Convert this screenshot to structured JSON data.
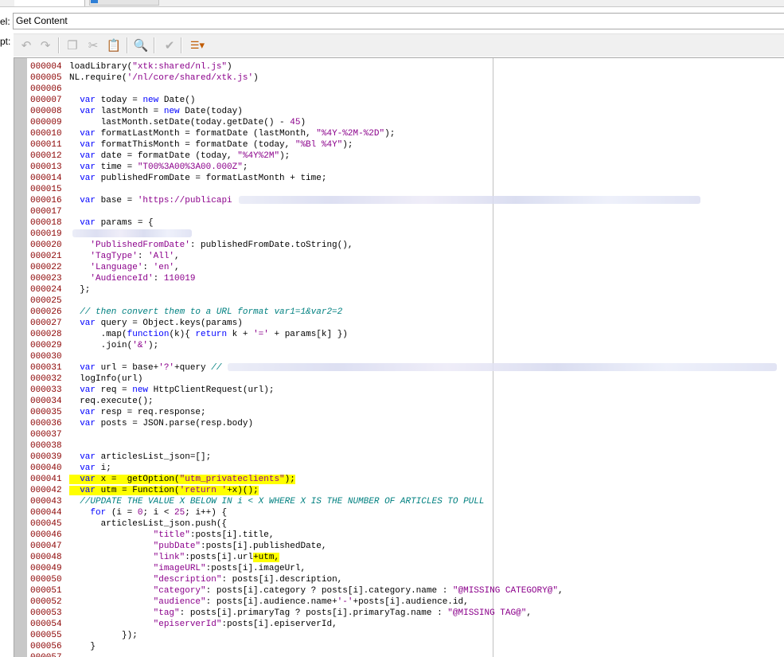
{
  "form": {
    "label_caption": "el:",
    "label_value": "Get Content",
    "script_caption": "pt:"
  },
  "toolbar": {
    "undo": "↶",
    "redo": "↷",
    "copy": "❐",
    "cut": "✂",
    "paste": "📋",
    "find": "🔍",
    "validate": "✔",
    "insert": "☰▾"
  },
  "code": {
    "line_numbers": [
      "000004",
      "000005",
      "000006",
      "000007",
      "000008",
      "000009",
      "000010",
      "000011",
      "000012",
      "000013",
      "000014",
      "000015",
      "000016",
      "000017",
      "000018",
      "000019",
      "000020",
      "000021",
      "000022",
      "000023",
      "000024",
      "000025",
      "000026",
      "000027",
      "000028",
      "000029",
      "000030",
      "000031",
      "000032",
      "000033",
      "000034",
      "000035",
      "000036",
      "000037",
      "000038",
      "000039",
      "000040",
      "000041",
      "000042",
      "000043",
      "000044",
      "000045",
      "000046",
      "000047",
      "000048",
      "000049",
      "000050",
      "000051",
      "000052",
      "000053",
      "000054",
      "000055",
      "000056",
      "000057"
    ],
    "lines": [
      [
        "loadLibrary(",
        "\"xtk:shared/nl.js\"",
        ")"
      ],
      [
        "NL.require(",
        "'/nl/core/shared/xtk.js'",
        ")"
      ],
      [
        ""
      ],
      [
        "  ",
        "var",
        " today = ",
        "new",
        " Date()"
      ],
      [
        "  ",
        "var",
        " lastMonth = ",
        "new",
        " Date(today)"
      ],
      [
        "      lastMonth.setDate(today.getDate() - ",
        "45",
        ")"
      ],
      [
        "  ",
        "var",
        " formatLastMonth = formatDate (lastMonth, ",
        "\"%4Y-%2M-%2D\"",
        ");"
      ],
      [
        "  ",
        "var",
        " formatThisMonth = formatDate (today, ",
        "\"%Bl %4Y\"",
        ");"
      ],
      [
        "  ",
        "var",
        " date = formatDate (today, ",
        "\"%4Y%2M\"",
        ");"
      ],
      [
        "  ",
        "var",
        " time = ",
        "\"T00%3A00%3A00.000Z\"",
        ";"
      ],
      [
        "  ",
        "var",
        " publishedFromDate = formatLastMonth + time;"
      ],
      [
        ""
      ],
      [
        "  ",
        "var",
        " base = ",
        "'https://publicapi"
      ],
      [
        ""
      ],
      [
        "  ",
        "var",
        " params = {"
      ],
      [
        ""
      ],
      [
        "    ",
        "'PublishedFromDate'",
        ": publishedFromDate.toString(),"
      ],
      [
        "    ",
        "'TagType'",
        ": ",
        "'All'",
        ","
      ],
      [
        "    ",
        "'Language'",
        ": ",
        "'en'",
        ","
      ],
      [
        "    ",
        "'AudienceId'",
        ": ",
        "110019"
      ],
      [
        "  };"
      ],
      [
        ""
      ],
      [
        "  ",
        "// then convert them to a URL format var1=1&var2=2"
      ],
      [
        "  ",
        "var",
        " query = Object.keys(params)"
      ],
      [
        "      .map(",
        "function",
        "(k){ ",
        "return",
        " k + ",
        "'='",
        " + params[k] })"
      ],
      [
        "      .join(",
        "'&'",
        ");"
      ],
      [
        ""
      ],
      [
        "  ",
        "var",
        " url = base+",
        "'?'",
        "+query ",
        "//"
      ],
      [
        "  logInfo(url)"
      ],
      [
        "  ",
        "var",
        " req = ",
        "new",
        " HttpClientRequest(url);"
      ],
      [
        "  req.execute();"
      ],
      [
        "  ",
        "var",
        " resp = req.response;"
      ],
      [
        "  ",
        "var",
        " posts = JSON.parse(resp.body)"
      ],
      [
        ""
      ],
      [
        ""
      ],
      [
        "  ",
        "var",
        " articlesList_json=[];"
      ],
      [
        "  ",
        "var",
        " i;"
      ],
      [
        "  ",
        "var",
        " x =  getOption(",
        "\"utm_privateclients\"",
        ");"
      ],
      [
        "  ",
        "var",
        " utm = Function(",
        "'return '",
        "+x)();"
      ],
      [
        "  ",
        "//UPDATE THE VALUE X BELOW IN i < X WHERE X IS THE NUMBER OF ARTICLES TO PULL"
      ],
      [
        "    ",
        "for",
        " (i = ",
        "0",
        "; i < ",
        "25",
        "; i++) {"
      ],
      [
        "      articlesList_json.push({"
      ],
      [
        "                ",
        "\"title\"",
        ":posts[i].title,"
      ],
      [
        "                ",
        "\"pubDate\"",
        ":posts[i].publishedDate,"
      ],
      [
        "                ",
        "\"link\"",
        ":posts[i].url",
        "+utm,"
      ],
      [
        "                ",
        "\"imageURL\"",
        ":posts[i].imageUrl,"
      ],
      [
        "                ",
        "\"description\"",
        ": posts[i].description,"
      ],
      [
        "                ",
        "\"category\"",
        ": posts[i].category ? posts[i].category.name : ",
        "\"@MISSING CATEGORY@\"",
        ","
      ],
      [
        "                ",
        "\"audience\"",
        ": posts[i].audience.name+",
        "'-'",
        "+posts[i].audience.id,"
      ],
      [
        "                ",
        "\"tag\"",
        ": posts[i].primaryTag ? posts[i].primaryTag.name : ",
        "\"@MISSING TAG@\"",
        ","
      ],
      [
        "                ",
        "\"episerverId\"",
        ":posts[i].episerverId,"
      ],
      [
        "          });"
      ],
      [
        "    }"
      ],
      [
        ""
      ]
    ]
  }
}
